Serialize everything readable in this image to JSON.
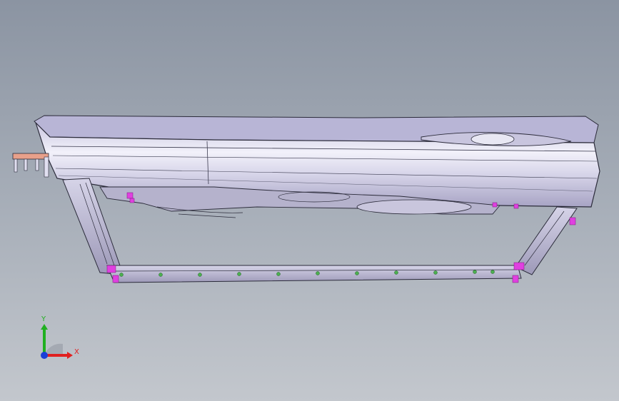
{
  "viewport": {
    "background_top": "#8b94a2",
    "background_bottom": "#c3c7cd"
  },
  "model": {
    "part": "automotive-door-trim-panel",
    "panel_color": "#d9d7ec",
    "edge_color": "#2b2b3a",
    "frame_color": "#b9b7cf",
    "clip_color_magenta": "#e040e0",
    "clip_color_green": "#4caf50",
    "bracket_color": "#e8a08a"
  },
  "triad": {
    "x_label": "X",
    "y_label": "Y",
    "x_color": "#e02020",
    "y_color": "#20b020",
    "origin_color": "#1a3fd8"
  }
}
